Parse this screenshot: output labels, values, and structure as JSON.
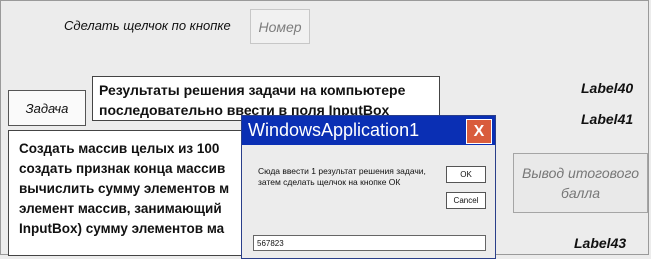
{
  "form": {
    "hint_text": "Сделать щелчок по кнопке",
    "nomer_button": "Номер",
    "zadacha_button": "Задача",
    "results_text": "Результаты решения задачи на компьютере последовательно ввести в поля InputBox",
    "task_lines": [
      "Создать массив целых из 100",
      "создать признак конца массив",
      "вычислить сумму элементов м",
      "элемент массив, занимающий",
      "InputBox) сумму элементов ма"
    ],
    "label40": "Label40",
    "label41": "Label41",
    "label43": "Label43",
    "vyvod_button": "Вывод итогового балла"
  },
  "dialog": {
    "title": "WindowsApplication1",
    "close_glyph": "X",
    "prompt_lines": [
      "Сюда ввести 1 результат решения задачи,",
      "затем сделать щелчок на кнопке ОК"
    ],
    "ok_label": "OK",
    "cancel_label": "Cancel",
    "input_value": "567823"
  }
}
